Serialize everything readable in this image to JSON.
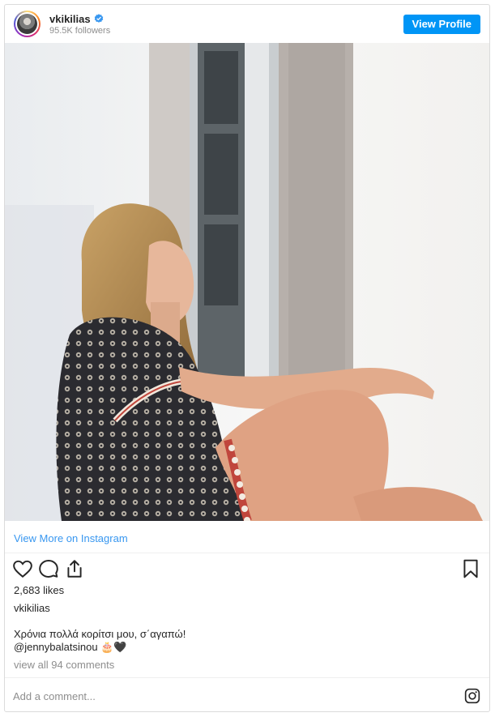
{
  "post": {
    "username": "vkikilias",
    "verified": true,
    "followers": "95.5K followers",
    "view_profile_label": "View Profile",
    "view_more_label": "View More on Instagram",
    "likes": "2,683 likes",
    "owner": "vkikilias",
    "caption_line1": "Χρόνια πολλά κορίτσι μου, σ΄αγαπώ!",
    "caption_mention": "@jennybalatsinou",
    "caption_emoji": "🎂🖤",
    "comments_label": "view all 94 comments",
    "comment_placeholder": "Add a comment..."
  },
  "icons": {
    "like": "heart-icon",
    "comment": "comment-bubble-icon",
    "share": "share-icon",
    "save": "bookmark-icon",
    "verified": "verified-badge-icon",
    "instagram": "instagram-logo-icon"
  },
  "colors": {
    "accent": "#0095f6",
    "link": "#3897f0",
    "muted": "#8e8e8e",
    "text": "#262626"
  }
}
